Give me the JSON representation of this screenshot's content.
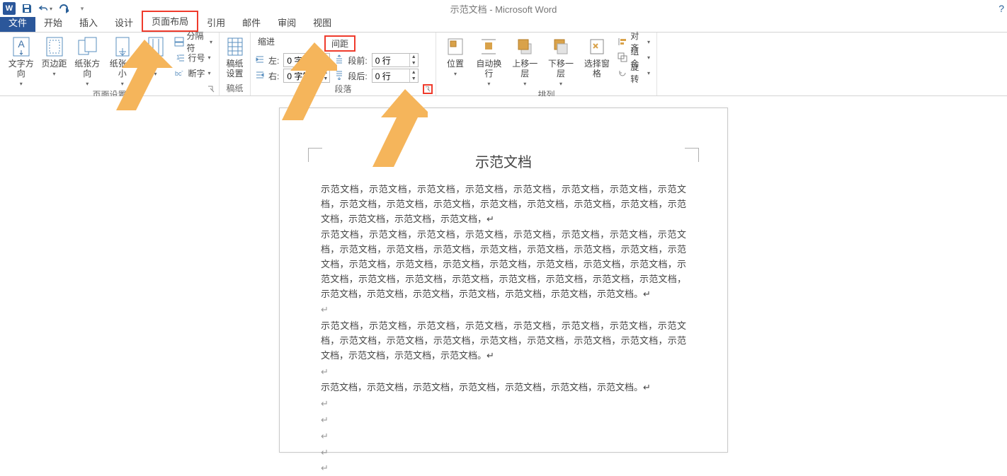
{
  "titlebar": {
    "doc_title": "示范文档 - Microsoft Word",
    "help": "?"
  },
  "tabs": {
    "file": "文件",
    "home": "开始",
    "insert": "插入",
    "design": "设计",
    "layout": "页面布局",
    "references": "引用",
    "mail": "邮件",
    "review": "审阅",
    "view": "视图"
  },
  "ribbon": {
    "page_setup": {
      "text_dir": "文字方向",
      "margins": "页边距",
      "orientation": "纸张方向",
      "size": "纸张大小",
      "columns": "分栏",
      "breaks": "分隔符",
      "line_num": "行号",
      "hyphen": "断字",
      "label": "页面设置"
    },
    "manuscript": {
      "btn": "稿纸\n设置",
      "label": "稿纸"
    },
    "paragraph": {
      "indent_hdr": "缩进",
      "spacing_hdr": "间距",
      "left_lbl": "左:",
      "right_lbl": "右:",
      "before_lbl": "段前:",
      "after_lbl": "段后:",
      "left_val": "0 字符",
      "right_val": "0 字符",
      "before_val": "0 行",
      "after_val": "0 行",
      "label": "段落"
    },
    "arrange": {
      "position": "位置",
      "wrap": "自动换行",
      "front": "上移一层",
      "back": "下移一层",
      "select": "选择窗格",
      "align": "对齐",
      "group": "组合",
      "rotate": "旋转",
      "label": "排列"
    }
  },
  "document": {
    "title": "示范文档",
    "p1": "示范文档，示范文档，示范文档，示范文档，示范文档，示范文档，示范文档，示范文档，示范文档，示范文档，示范文档，示范文档，示范文档，示范文档，示范文档，示范文档，示范文档，示范文档，示范文档，↵",
    "p2": "示范文档，示范文档，示范文档，示范文档，示范文档，示范文档，示范文档，示范文档，示范文档，示范文档，示范文档，示范文档，示范文档，示范文档，示范文档，示范文档，示范文档，示范文档，示范文档，示范文档，示范文档，示范文档，示范文档，示范文档，示范文档，示范文档，示范文档，示范文档，示范文档，示范文档，示范文档，示范文档，示范文档，示范文档，示范文档，示范文档，示范文档，示范文档。↵",
    "p3": "↵",
    "p4": "示范文档，示范文档，示范文档，示范文档，示范文档，示范文档，示范文档，示范文档，示范文档，示范文档，示范文档，示范文档，示范文档，示范文档，示范文档，示范文档，示范文档，示范文档，示范文档。↵",
    "p5": "↵",
    "p6": "示范文档，示范文档，示范文档，示范文档，示范文档，示范文档，示范文档。↵",
    "p7": "↵",
    "p8": "↵",
    "p9": "↵",
    "p10": "↵",
    "p11": "↵"
  }
}
